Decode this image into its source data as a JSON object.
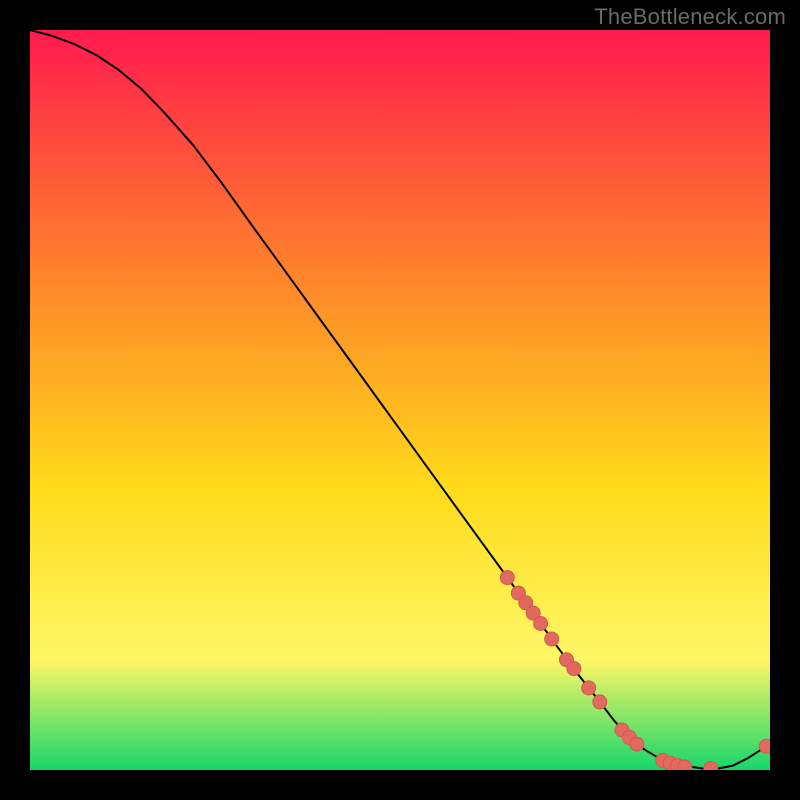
{
  "watermark": "TheBottleneck.com",
  "colors": {
    "gradient_top": "#ff1a4d",
    "gradient_mid1": "#ff8a29",
    "gradient_mid2": "#ffdb1a",
    "gradient_mid3": "#fff766",
    "gradient_bottom": "#17d66a",
    "line": "#000000",
    "marker_fill": "#e2695d",
    "marker_stroke": "#cf5b50"
  },
  "chart_data": {
    "type": "line",
    "title": "",
    "xlabel": "",
    "ylabel": "",
    "xlim": [
      0,
      100
    ],
    "ylim": [
      0,
      100
    ],
    "series": [
      {
        "name": "curve",
        "x": [
          0,
          3,
          6,
          9,
          12,
          15,
          18,
          22,
          26,
          30,
          35,
          40,
          45,
          50,
          55,
          60,
          64,
          68,
          71,
          74,
          77,
          79,
          81,
          83,
          85,
          88,
          91,
          93,
          95,
          97,
          99.5
        ],
        "y": [
          100,
          99.2,
          98.1,
          96.6,
          94.6,
          92.1,
          89.0,
          84.5,
          79.2,
          73.6,
          66.7,
          59.8,
          52.9,
          46.0,
          39.1,
          32.2,
          26.7,
          21.2,
          17.0,
          13.0,
          9.2,
          6.6,
          4.4,
          2.8,
          1.6,
          0.6,
          0.2,
          0.2,
          0.6,
          1.6,
          3.2
        ]
      }
    ],
    "markers": {
      "x": [
        64.5,
        66.0,
        67.0,
        68.0,
        69.0,
        70.5,
        72.5,
        73.5,
        75.5,
        77.0,
        80.0,
        81.0,
        82.0,
        85.5,
        86.5,
        87.5,
        88.5,
        92.0,
        99.5
      ],
      "y": [
        26.0,
        23.9,
        22.6,
        21.2,
        19.8,
        17.7,
        14.9,
        13.7,
        11.1,
        9.2,
        5.4,
        4.4,
        3.5,
        1.3,
        0.9,
        0.6,
        0.4,
        0.2,
        3.2
      ]
    }
  }
}
